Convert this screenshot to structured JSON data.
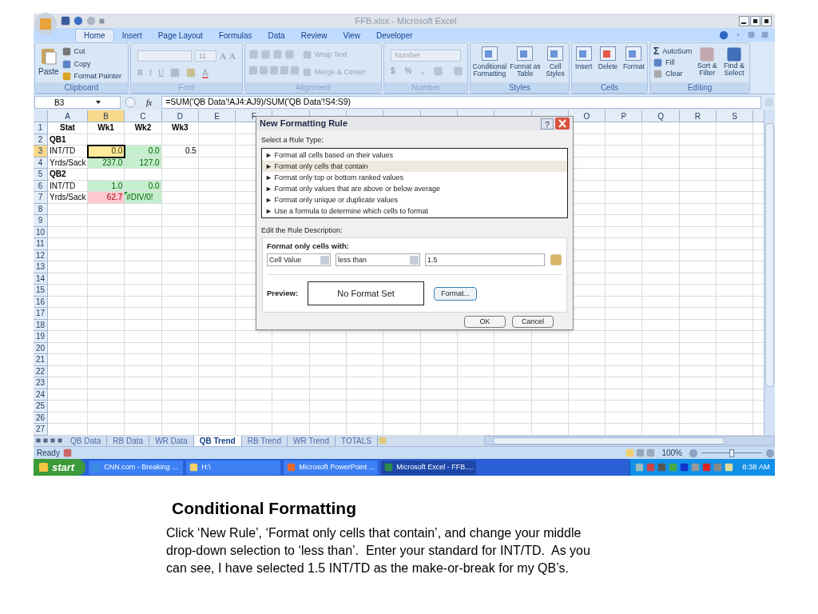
{
  "window": {
    "title": "FFB.xlsx - Microsoft Excel"
  },
  "tabs": [
    {
      "label": "Home",
      "selected": true
    },
    {
      "label": "Insert",
      "selected": false
    },
    {
      "label": "Page Layout",
      "selected": false
    },
    {
      "label": "Formulas",
      "selected": false
    },
    {
      "label": "Data",
      "selected": false
    },
    {
      "label": "Review",
      "selected": false
    },
    {
      "label": "View",
      "selected": false
    },
    {
      "label": "Developer",
      "selected": false
    }
  ],
  "ribbon": {
    "groups": [
      {
        "kind": "clipboard",
        "label": "Clipboard",
        "disabled": false,
        "items": [
          "Paste",
          "Cut",
          "Copy",
          "Format Painter"
        ]
      },
      {
        "kind": "font",
        "label": "Font",
        "disabled": true,
        "size": "11",
        "buttons": [
          "A",
          "A",
          "B",
          "I",
          "U",
          "A"
        ]
      },
      {
        "kind": "alignment",
        "label": "Alignment",
        "disabled": true,
        "items": [
          "Wrap Text",
          "Merge & Center"
        ]
      },
      {
        "kind": "number",
        "label": "Number",
        "disabled": true,
        "format": "Number",
        "buttons": [
          "$",
          "%",
          ","
        ]
      },
      {
        "kind": "styles",
        "label": "Styles",
        "disabled": false,
        "items": [
          "Conditional Formatting",
          "Format as Table",
          "Cell Styles"
        ]
      },
      {
        "kind": "cells",
        "label": "Cells",
        "disabled": false,
        "items": [
          "Insert",
          "Delete",
          "Format"
        ]
      },
      {
        "kind": "editing",
        "label": "Editing",
        "disabled": false,
        "sigma": "Σ",
        "items": [
          "AutoSum",
          "Fill",
          "Clear",
          "Sort & Filter",
          "Find & Select"
        ]
      }
    ]
  },
  "formula_bar": {
    "name_box": "B3",
    "fx": "fx",
    "formula": "=SUM('QB Data'!AJ4:AJ9)/SUM('QB Data'!S4:S9)"
  },
  "sheet": {
    "columns_left": [
      {
        "label": "A",
        "selected": false
      },
      {
        "label": "B",
        "selected": true
      },
      {
        "label": "C",
        "selected": false
      },
      {
        "label": "D",
        "selected": false
      },
      {
        "label": "E",
        "selected": false
      },
      {
        "label": "F",
        "selected": false
      }
    ],
    "columns_right": [
      {
        "label": "O",
        "selected": false
      },
      {
        "label": "P",
        "selected": false
      },
      {
        "label": "Q",
        "selected": false
      },
      {
        "label": "R",
        "selected": false
      },
      {
        "label": "S",
        "selected": false
      }
    ],
    "rows": [
      {
        "label": "1",
        "selected": false,
        "cells": [
          {
            "text": "Stat",
            "kind": "header",
            "selected": false
          },
          {
            "text": "Wk1",
            "kind": "header",
            "selected": false
          },
          {
            "text": "Wk2",
            "kind": "header",
            "selected": false
          },
          {
            "text": "Wk3",
            "kind": "header",
            "selected": false
          }
        ]
      },
      {
        "label": "2",
        "selected": false,
        "cells": [
          {
            "text": "QB1",
            "kind": "group",
            "selected": false
          }
        ]
      },
      {
        "label": "3",
        "selected": true,
        "cells": [
          {
            "text": "INT/TD",
            "kind": "text",
            "selected": false
          },
          {
            "text": "0.0",
            "kind": "number",
            "color": "#ffeb9c",
            "selected": true
          },
          {
            "text": "0.0",
            "kind": "number",
            "color": "#c6efce",
            "selected": false
          },
          {
            "text": "0.5",
            "kind": "number",
            "selected": false
          }
        ]
      },
      {
        "label": "4",
        "selected": false,
        "cells": [
          {
            "text": "Yrds/Sack",
            "kind": "text",
            "selected": false
          },
          {
            "text": "237.0",
            "kind": "number",
            "color": "#c6efce",
            "selected": false
          },
          {
            "text": "127.0",
            "kind": "number",
            "color": "#c6efce",
            "selected": false
          }
        ]
      },
      {
        "label": "5",
        "selected": false,
        "cells": [
          {
            "text": "QB2",
            "kind": "group",
            "selected": false
          }
        ]
      },
      {
        "label": "6",
        "selected": false,
        "cells": [
          {
            "text": "INT/TD",
            "kind": "text",
            "selected": false
          },
          {
            "text": "1.0",
            "kind": "number",
            "color": "#c6efce",
            "selected": false
          },
          {
            "text": "0.0",
            "kind": "number",
            "color": "#c6efce",
            "selected": false
          }
        ]
      },
      {
        "label": "7",
        "selected": false,
        "cells": [
          {
            "text": "Yrds/Sack",
            "kind": "text",
            "selected": false
          },
          {
            "text": "62.7",
            "kind": "number",
            "color": "#ffc7ce",
            "selected": false
          },
          {
            "text": "#DIV/0!",
            "kind": "error",
            "color": "#c6efce",
            "selected": false
          }
        ]
      },
      {
        "label": "8",
        "selected": false
      },
      {
        "label": "9",
        "selected": false
      },
      {
        "label": "10",
        "selected": false
      },
      {
        "label": "11",
        "selected": false
      },
      {
        "label": "12",
        "selected": false
      },
      {
        "label": "13",
        "selected": false
      },
      {
        "label": "14",
        "selected": false
      },
      {
        "label": "15",
        "selected": false
      },
      {
        "label": "16",
        "selected": false
      },
      {
        "label": "17",
        "selected": false
      },
      {
        "label": "18",
        "selected": false
      },
      {
        "label": "19",
        "selected": false
      },
      {
        "label": "20",
        "selected": false
      },
      {
        "label": "21",
        "selected": false
      },
      {
        "label": "22",
        "selected": false
      },
      {
        "label": "23",
        "selected": false
      },
      {
        "label": "24",
        "selected": false
      },
      {
        "label": "25",
        "selected": false
      },
      {
        "label": "26",
        "selected": false
      },
      {
        "label": "27",
        "selected": false
      }
    ]
  },
  "dialog": {
    "title": "New Formatting Rule",
    "help": "?",
    "rule_type_label": "Select a Rule Type:",
    "rule_types": [
      {
        "label": "► Format all cells based on their values",
        "selected": false
      },
      {
        "label": "► Format only cells that contain",
        "selected": true
      },
      {
        "label": "► Format only top or bottom ranked values",
        "selected": false
      },
      {
        "label": "► Format only values that are above or below average",
        "selected": false
      },
      {
        "label": "► Format only unique or duplicate values",
        "selected": false
      },
      {
        "label": "► Use a formula to determine which cells to format",
        "selected": false
      }
    ],
    "description_label": "Edit the Rule Description:",
    "condition_label": "Format only cells with:",
    "operand": "Cell Value",
    "operator": "less than",
    "value": "1.5",
    "preview_label": "Preview:",
    "preview_text": "No Format Set",
    "format_button": "Format...",
    "buttons": [
      "OK",
      "Cancel"
    ]
  },
  "sheet_tabs": [
    {
      "label": "QB Data",
      "selected": false
    },
    {
      "label": "RB Data",
      "selected": false
    },
    {
      "label": "WR Data",
      "selected": false
    },
    {
      "label": "QB Trend",
      "selected": true
    },
    {
      "label": "RB Trend",
      "selected": false
    },
    {
      "label": "WR Trend",
      "selected": false
    },
    {
      "label": "TOTALS",
      "selected": false
    }
  ],
  "status_bar": {
    "status": "Ready",
    "zoom": {
      "reading": "100%",
      "level": 0.5
    }
  },
  "taskbar": {
    "start": "start",
    "windows": [
      {
        "label": "CNN.com - Breaking ...",
        "selected": false
      },
      {
        "label": "H:\\",
        "selected": false
      },
      {
        "label": "Microsoft PowerPoint ...",
        "selected": false
      },
      {
        "label": "Microsoft Excel - FFB....",
        "selected": true
      }
    ],
    "clock": "8:38 AM"
  },
  "slide": {
    "title": "Conditional Formatting",
    "body": "Click ‘New Rule’, ‘Format only cells that contain’, and change your middle drop-down selection to ‘less than’.  Enter your standard for INT/TD.  As you can see, I have selected 1.5 INT/TD as the make-or-break for my QB’s."
  }
}
